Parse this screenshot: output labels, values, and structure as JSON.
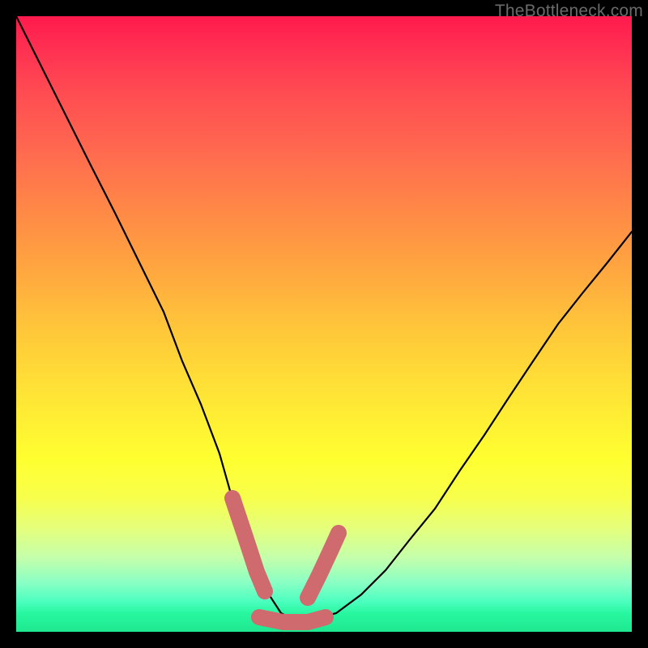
{
  "watermark": "TheBottleneck.com",
  "colors": {
    "frame": "#000000",
    "curve": "#000000",
    "marker": "#cf6a6f"
  },
  "chart_data": {
    "type": "line",
    "title": "",
    "xlabel": "",
    "ylabel": "",
    "xlim": [
      0,
      100
    ],
    "ylim": [
      0,
      100
    ],
    "grid": false,
    "series": [
      {
        "name": "bottleneck-curve",
        "x": [
          0,
          4,
          8,
          12,
          16,
          20,
          24,
          27,
          30,
          33,
          35,
          37,
          39,
          41,
          43,
          45,
          48,
          52,
          56,
          60,
          64,
          68,
          72,
          76,
          80,
          84,
          88,
          92,
          96,
          100
        ],
        "y": [
          100,
          92,
          84,
          76,
          68,
          60,
          52,
          44,
          37,
          29,
          22,
          16,
          10,
          6,
          3,
          2,
          2,
          3,
          6,
          10,
          15,
          20,
          26,
          32,
          38,
          44,
          50,
          55,
          60,
          65
        ]
      }
    ],
    "markers": [
      {
        "name": "left-marker",
        "x_range": [
          35,
          38
        ],
        "note": "thick salmon segment on left descent near bottom"
      },
      {
        "name": "right-marker",
        "x_range": [
          45,
          48
        ],
        "note": "thick salmon segment on right ascent near bottom"
      },
      {
        "name": "floor-marker",
        "x_range": [
          38,
          45
        ],
        "note": "thick salmon segment along valley floor"
      }
    ]
  }
}
